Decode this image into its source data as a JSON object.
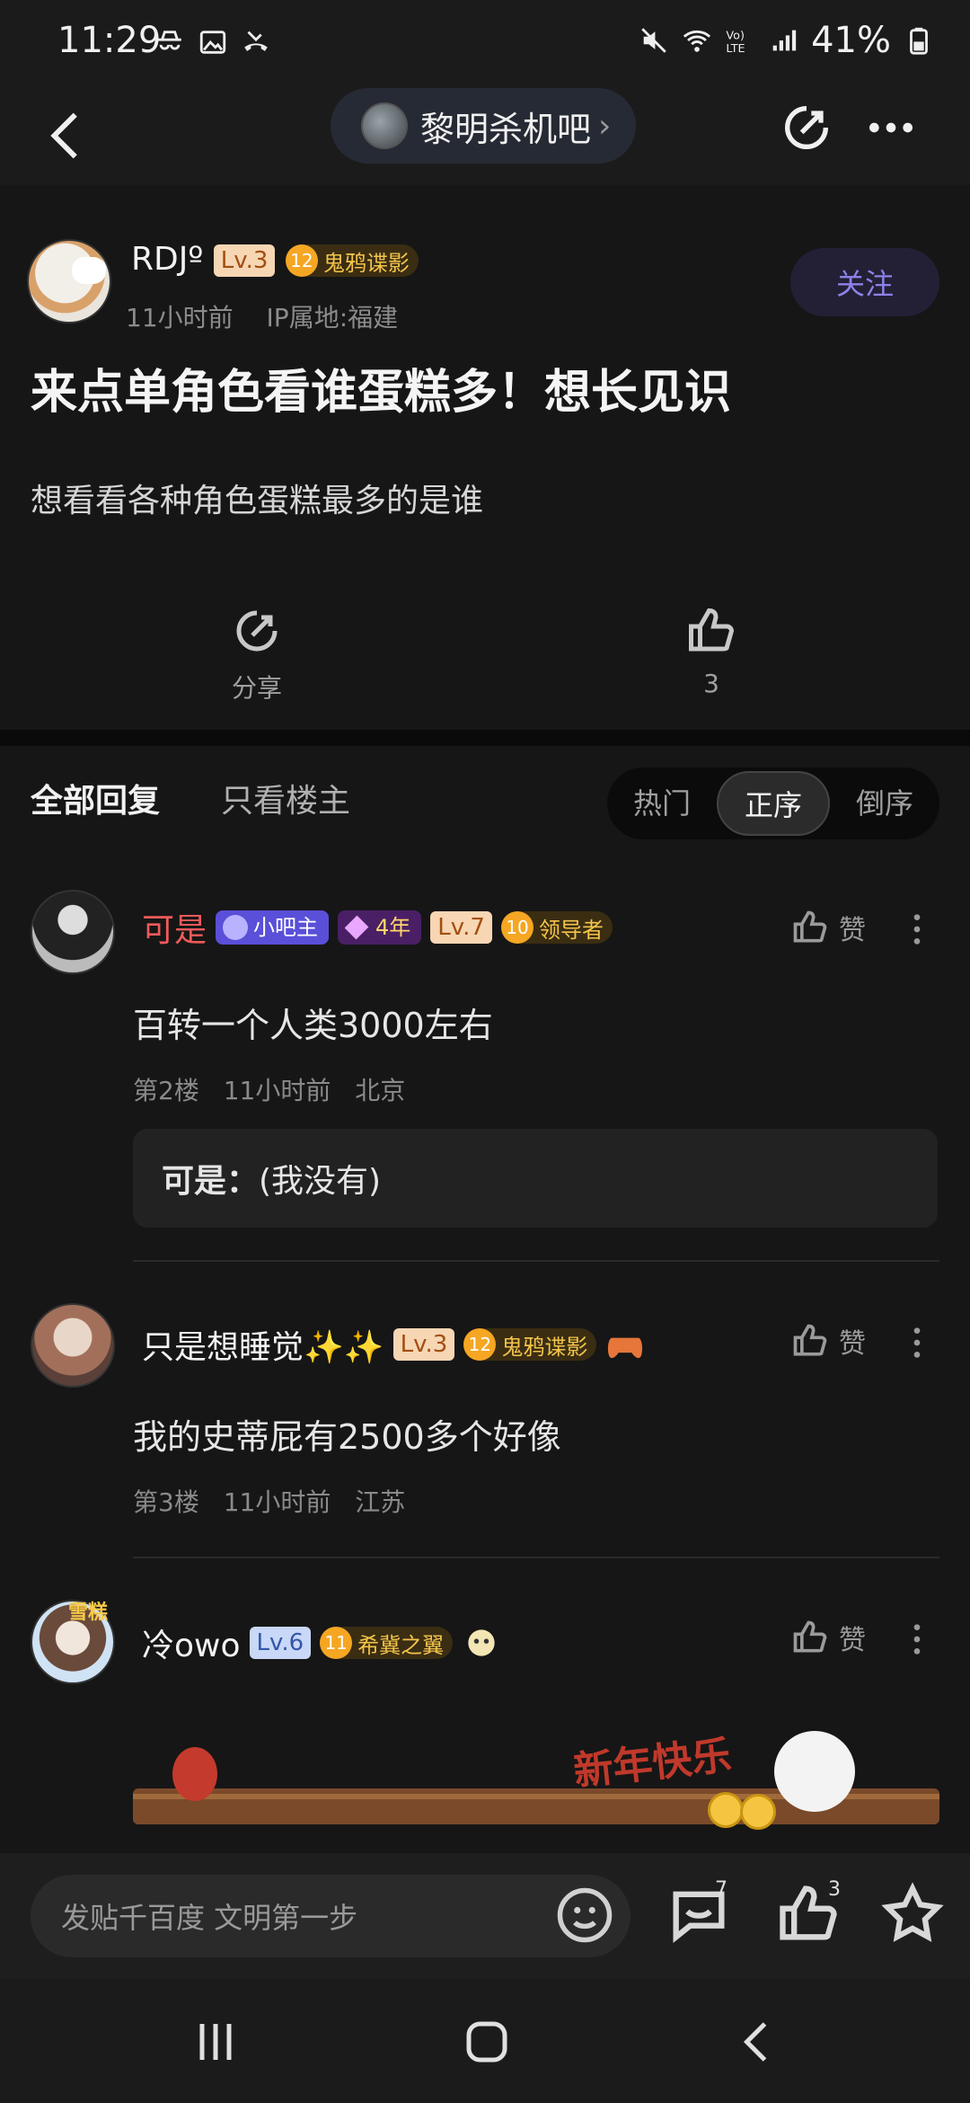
{
  "status_bar": {
    "time": "11:29",
    "battery": "41%"
  },
  "header": {
    "forum_name": "黎明杀机吧"
  },
  "post": {
    "author": {
      "name": "RDJº",
      "level": "Lv.3",
      "title_level": "12",
      "title": "鬼鸦谍影"
    },
    "time": "11小时前",
    "ip": "IP属地:福建",
    "follow_label": "关注",
    "title": "来点单角色看谁蛋糕多！想长见识",
    "body": "想看看各种角色蛋糕最多的是谁",
    "share_label": "分享",
    "like_count": "3"
  },
  "replies_header": {
    "all": "全部回复",
    "op_only": "只看楼主",
    "sort": [
      "热门",
      "正序",
      "倒序"
    ],
    "sort_active": 1
  },
  "replies": [
    {
      "name": "可是",
      "badges": {
        "mod": "小吧主",
        "years": "4年",
        "level": "Lv.7",
        "title_level": "10",
        "title": "领导者"
      },
      "text": "百转一个人类3000左右",
      "floor": "第2楼",
      "time": "11小时前",
      "location": "北京",
      "like_label": "赞",
      "sub_reply": {
        "author": "可是：",
        "text": "(我没有)"
      }
    },
    {
      "name": "只是想睡觉✨✨",
      "badges": {
        "level": "Lv.3",
        "title_level": "12",
        "title": "鬼鸦谍影"
      },
      "text": "我的史蒂屁有2500多个好像",
      "floor": "第3楼",
      "time": "11小时前",
      "location": "江苏",
      "like_label": "赞"
    },
    {
      "name": "冷owo",
      "badges": {
        "level": "Lv.6",
        "title_level": "11",
        "title": "希冀之翼"
      },
      "like_label": "赞",
      "banner_text": "新年快乐",
      "avatar_tag": "雪糕"
    }
  ],
  "bottom_bar": {
    "placeholder": "发贴千百度 文明第一步",
    "comment_count": "7",
    "like_count": "3"
  },
  "colors": {
    "accent": "#8d82e8",
    "red_name": "#f05a5a",
    "badge_gold": "#f4c44b"
  }
}
